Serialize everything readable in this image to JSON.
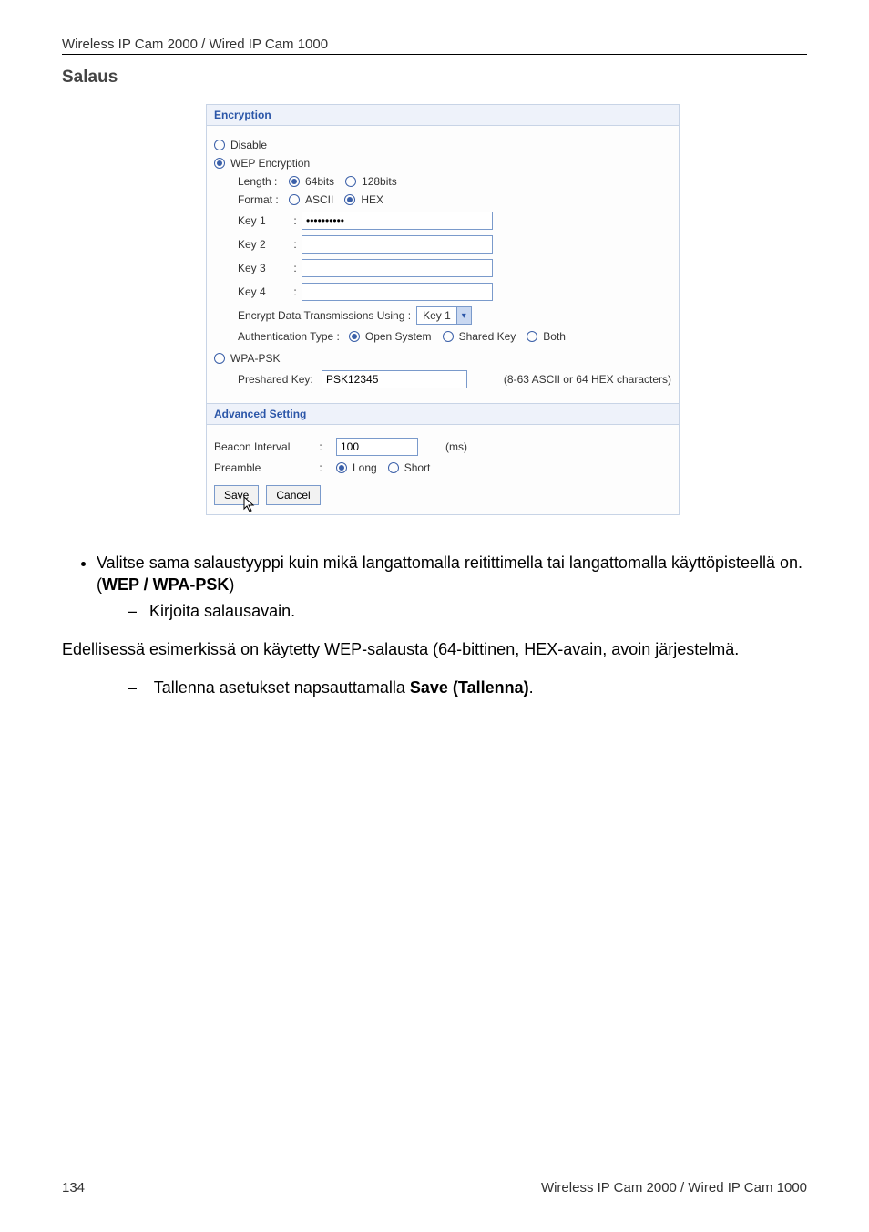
{
  "header": {
    "top_text": "Wireless IP Cam 2000 / Wired IP Cam 1000"
  },
  "section_title": "Salaus",
  "panel": {
    "encryption_header": "Encryption",
    "disable_label": "Disable",
    "wep_label": "WEP Encryption",
    "length_label": "Length :",
    "len_64": "64bits",
    "len_128": "128bits",
    "format_label": "Format :",
    "fmt_ascii": "ASCII",
    "fmt_hex": "HEX",
    "key1_label": "Key 1",
    "key2_label": "Key 2",
    "key3_label": "Key 3",
    "key4_label": "Key 4",
    "key1_value": "••••••••••",
    "key2_value": "",
    "key3_value": "",
    "key4_value": "",
    "encrypt_using_label": "Encrypt Data Transmissions Using  :",
    "encrypt_using_value": "Key 1",
    "auth_type_label": "Authentication Type  :",
    "auth_open": "Open System",
    "auth_shared": "Shared Key",
    "auth_both": "Both",
    "wpa_label": "WPA-PSK",
    "psk_label": "Preshared Key:",
    "psk_value": "PSK12345",
    "psk_hint": "(8-63 ASCII or 64 HEX characters)",
    "advanced_header": "Advanced Setting",
    "beacon_label": "Beacon Interval",
    "beacon_value": "100",
    "beacon_unit": "(ms)",
    "preamble_label": "Preamble",
    "preamble_long": "Long",
    "preamble_short": "Short",
    "save_btn": "Save",
    "cancel_btn": "Cancel"
  },
  "instructions": {
    "bullet1_a": "Valitse sama salaustyyppi kuin mikä langattomalla reitittimella tai langattomalla käyttöpisteellä on. (",
    "bullet1_bold": "WEP / WPA-PSK",
    "bullet1_b": ")",
    "sub1": "Kirjoita salausavain.",
    "para": "Edellisessä esimerkissä on käytetty WEP-salausta (64-bittinen, HEX-avain, avoin järjestelmä.",
    "sub2_a": "Tallenna asetukset napsauttamalla ",
    "sub2_bold": "Save (Tallenna)",
    "sub2_b": "."
  },
  "footer": {
    "page_num": "134",
    "right_text": "Wireless IP Cam 2000 / Wired IP Cam 1000"
  }
}
